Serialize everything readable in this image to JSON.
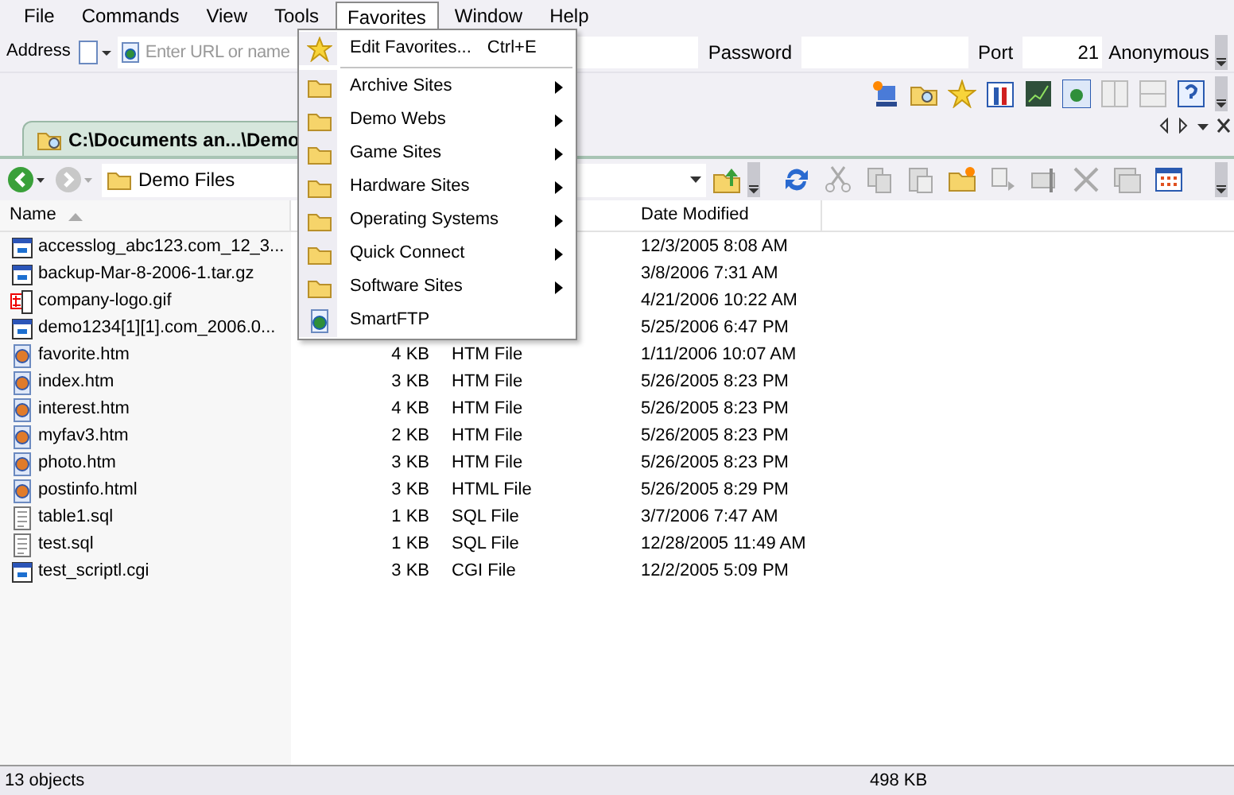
{
  "menu_bar": [
    {
      "label": "File",
      "selected": false
    },
    {
      "label": "Commands",
      "selected": false
    },
    {
      "label": "View",
      "selected": false
    },
    {
      "label": "Tools",
      "selected": false
    },
    {
      "label": "Favorites",
      "selected": true
    },
    {
      "label": "Window",
      "selected": false
    },
    {
      "label": "Help",
      "selected": false
    }
  ],
  "address_bar": {
    "label": "Address",
    "url_placeholder": "Enter URL or name",
    "password_label": "Password",
    "port_label": "Port",
    "port": "21",
    "anonymous_label": "Anonymous"
  },
  "tab": {
    "title": "C:\\Documents an...\\Demo"
  },
  "nav_bar": {
    "path": "Demo Files"
  },
  "file_list": {
    "columns": [
      {
        "label": "Name",
        "sorted": true
      },
      {
        "label": "Date Modified",
        "sorted": false
      }
    ],
    "rows": [
      {
        "kind": "app",
        "name": "accesslog_abc123.com_12_3...",
        "date": "12/3/2005 8:08 AM"
      },
      {
        "kind": "app",
        "name": "backup-Mar-8-2006-1.tar.gz",
        "date": "3/8/2006 7:31 AM"
      },
      {
        "kind": "image",
        "name": "company-logo.gif",
        "date": "4/21/2006 10:22 AM"
      },
      {
        "kind": "app",
        "name": "demo1234[1][1].com_2006.0...",
        "date": "5/25/2006 6:47 PM"
      },
      {
        "kind": "web",
        "name": "favorite.htm",
        "size": "4 KB",
        "type": "HTM File",
        "date": "1/11/2006 10:07 AM"
      },
      {
        "kind": "web",
        "name": "index.htm",
        "size": "3 KB",
        "type": "HTM File",
        "date": "5/26/2005 8:23 PM"
      },
      {
        "kind": "web",
        "name": "interest.htm",
        "size": "4 KB",
        "type": "HTM File",
        "date": "5/26/2005 8:23 PM"
      },
      {
        "kind": "web",
        "name": "myfav3.htm",
        "size": "2 KB",
        "type": "HTM File",
        "date": "5/26/2005 8:23 PM"
      },
      {
        "kind": "web",
        "name": "photo.htm",
        "size": "3 KB",
        "type": "HTM File",
        "date": "5/26/2005 8:23 PM"
      },
      {
        "kind": "web",
        "name": "postinfo.html",
        "size": "3 KB",
        "type": "HTML File",
        "date": "5/26/2005 8:29 PM"
      },
      {
        "kind": "text",
        "name": "table1.sql",
        "size": "1 KB",
        "type": "SQL File",
        "date": "3/7/2006 7:47 AM"
      },
      {
        "kind": "text",
        "name": "test.sql",
        "size": "1 KB",
        "type": "SQL File",
        "date": "12/28/2005 11:49 AM"
      },
      {
        "kind": "app",
        "name": "test_scriptl.cgi",
        "size": "3 KB",
        "type": "CGI File",
        "date": "12/2/2005 5:09 PM"
      }
    ]
  },
  "favorites_menu": [
    {
      "kind": "star",
      "label": "Edit Favorites...",
      "shortcut": "Ctrl+E",
      "submenu": false
    },
    {
      "kind": "separator"
    },
    {
      "kind": "folder",
      "label": "Archive Sites",
      "submenu": true
    },
    {
      "kind": "folder",
      "label": "Demo Webs",
      "submenu": true
    },
    {
      "kind": "folder",
      "label": "Game Sites",
      "submenu": true
    },
    {
      "kind": "folder",
      "label": "Hardware Sites",
      "submenu": true
    },
    {
      "kind": "folder",
      "label": "Operating Systems",
      "submenu": true
    },
    {
      "kind": "folder",
      "label": "Quick Connect",
      "submenu": true
    },
    {
      "kind": "folder",
      "label": "Software Sites",
      "submenu": true
    },
    {
      "kind": "web",
      "label": "SmartFTP",
      "submenu": false
    }
  ],
  "status_bar": {
    "objects": "13 objects",
    "total_size": "498 KB"
  }
}
